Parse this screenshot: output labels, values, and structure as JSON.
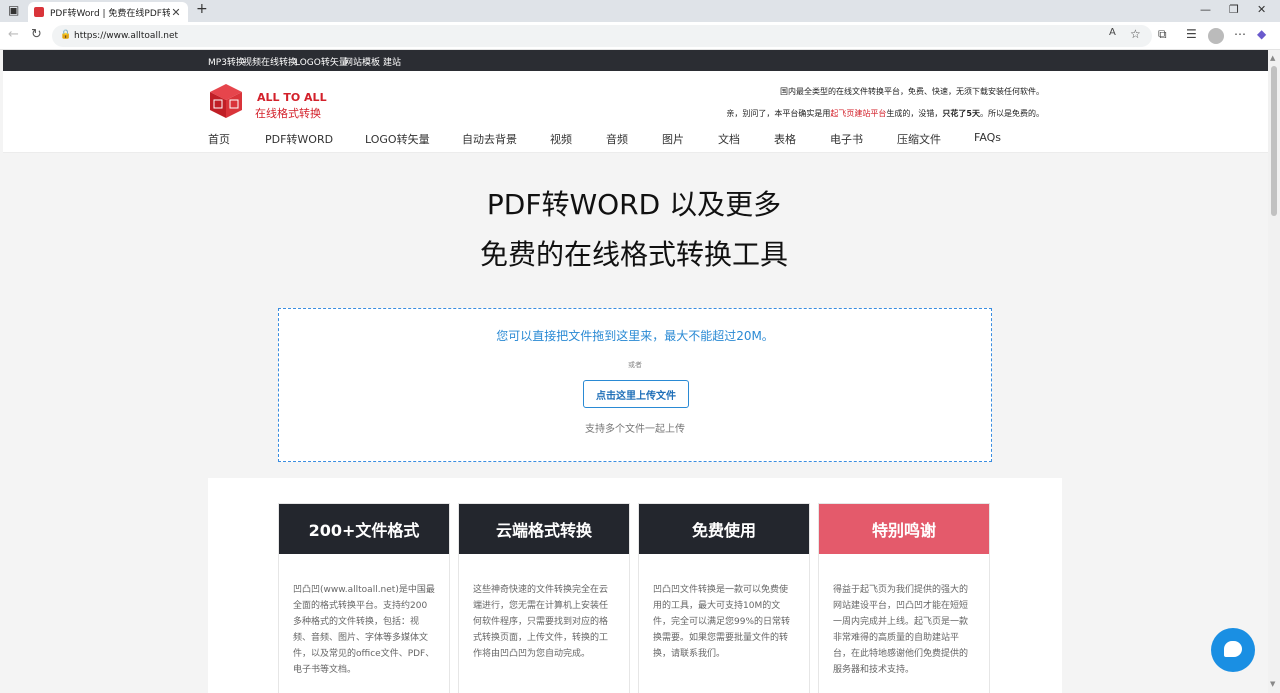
{
  "browser": {
    "tab_title": "PDF转Word | 免费在线PDF转Word",
    "url": "https://www.alltoall.net"
  },
  "topbar": {
    "links": [
      "MP3转换",
      "视频在线转换",
      "LOGO转矢量",
      "网站模板",
      "建站"
    ]
  },
  "header": {
    "logo_en": "ALL TO ALL",
    "logo_cn": "在线格式转换",
    "slogan1": "国内最全类型的在线文件转换平台，免费、快速，无须下载安装任何软件。",
    "slogan2_a": "亲，别问了，本平台确实是用",
    "slogan2_link": "起飞页建站平台",
    "slogan2_b": "生成的，没错，",
    "slogan2_bold": "只花了5天",
    "slogan2_c": "。所以是免费的。"
  },
  "nav": {
    "items": [
      "首页",
      "PDF转WORD",
      "LOGO转矢量",
      "自动去背景",
      "视频",
      "音频",
      "图片",
      "文档",
      "表格",
      "电子书",
      "压缩文件",
      "FAQs"
    ]
  },
  "hero": {
    "line1": "PDF转WORD 以及更多",
    "line2": "免费的在线格式转换工具"
  },
  "dropzone": {
    "main": "您可以直接把文件拖到这里来，最大不能超过20M。",
    "or": "或者",
    "button": "点击这里上传文件",
    "sub": "支持多个文件一起上传"
  },
  "cards": [
    {
      "title": "200+文件格式",
      "body": "凹凸凹(www.alltoall.net)是中国最全面的格式转换平台。支持约200多种格式的文件转换，包括：视频、音频、图片、字体等多媒体文件，以及常见的office文件、PDF、电子书等文档。"
    },
    {
      "title": "云端格式转换",
      "body": "这些神奇快速的文件转换完全在云端进行，您无需在计算机上安装任何软件程序，只需要找到对应的格式转换页面，上传文件，转换的工作将由凹凸凹为您自动完成。"
    },
    {
      "title": "免费使用",
      "body": "凹凸凹文件转换是一款可以免费使用的工具，最大可支持10M的文件，完全可以满足您99%的日常转换需要。如果您需要批量文件的转换，请联系我们。"
    },
    {
      "title": "特别鸣谢",
      "body": "得益于起飞页为我们提供的强大的网站建设平台，凹凸凹才能在短短一周内完成并上线。起飞页是一款非常难得的高质量的自助建站平台，在此特地感谢他们免费提供的服务器和技术支持。"
    }
  ],
  "colors": {
    "brand_red": "#d3202a",
    "accent_blue": "#2a8ad4",
    "card_dark": "#23262d",
    "card_pink": "#e45a6b"
  }
}
